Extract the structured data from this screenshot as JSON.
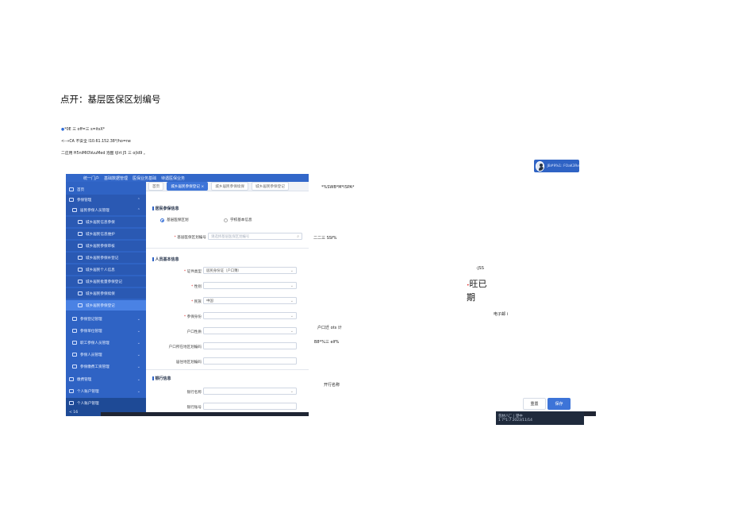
{
  "doc": {
    "title": "点开：基层医保区划编号",
    "line1": "*0E 三 off=三 s=itsX*",
    "line2": "<--»CA 不安全 I10.61.152.38*/ho=ne",
    "line3": "二应用 H5niMIOVuuMed 泡图 tJlrt J5 三 o|ld9 。"
  },
  "app": {
    "topnav": [
      "统一门户",
      "基础数据管理",
      "医保业务基础",
      "待遇医保业务"
    ],
    "sidebar": [
      {
        "label": "首页"
      },
      {
        "label": "参保管理"
      },
      {
        "label": "居民参保人员管理"
      },
      {
        "label": "城乡居民信息参保"
      },
      {
        "label": "城乡居民信息维护"
      },
      {
        "label": "城乡居民参保审核"
      },
      {
        "label": "城乡居民参保补登记"
      },
      {
        "label": "城乡居民个人信息"
      },
      {
        "label": "城乡居民批量参保登记"
      },
      {
        "label": "城乡居民参保续保"
      },
      {
        "label": "城乡居民参保登记"
      },
      {
        "label": "参保登记管理"
      },
      {
        "label": "参保单位管理"
      },
      {
        "label": "职工参保人员管理"
      },
      {
        "label": "参保人员管理"
      },
      {
        "label": "参保缴费工资管理"
      },
      {
        "label": "缴费管理"
      },
      {
        "label": "个人账户管理"
      },
      {
        "label": "个人账户管理"
      }
    ],
    "footer_left": "< 16",
    "tabs": [
      "首页",
      "城乡居民参保登记 ×",
      "城乡居民参保续保",
      "城乡居民参保登记"
    ],
    "sections": {
      "basic": "居民参保信息",
      "person": "人员基本信息",
      "bank": "银行信息"
    },
    "radios": {
      "opt1": "基层医保区划",
      "opt2": "学校基本信息"
    },
    "fields": {
      "code_label": "基层医保区划编号",
      "code_placeholder": "请选择基层医保区划编号",
      "id_type_label": "证件类型",
      "id_type_value": "居民身份证（户口簿）",
      "gender_label": "性别",
      "ethnic_label": "民族",
      "ethnic_value": "中国",
      "status_label": "参保身份",
      "hukou_label": "户口性质",
      "hukou_region_label": "户口所在地区划编码",
      "live_region_label": "居住地区划编码",
      "bank_label": "银行名称",
      "bank2_label": "银行账号"
    }
  },
  "right": {
    "avatar_name": "JB#9%1: FOaK3Re",
    "label_top": "*%SWB*M*ISPA*",
    "label_ssf": "二二三 SSf%",
    "label_jss": "-JSS",
    "big1": "旺已",
    "big2": "期",
    "label_email": "电子邮 i",
    "label_hukou": "户口迁 ots 计",
    "label_b8": "B8*%三 elf%",
    "label_bank": "开行名称",
    "btn_reset": "重置",
    "btn_save": "保存",
    "taskbar_line1": "苞材八匚 |   望中",
    "taskbar_line2": "1 7*1:7  2023/11/14"
  }
}
